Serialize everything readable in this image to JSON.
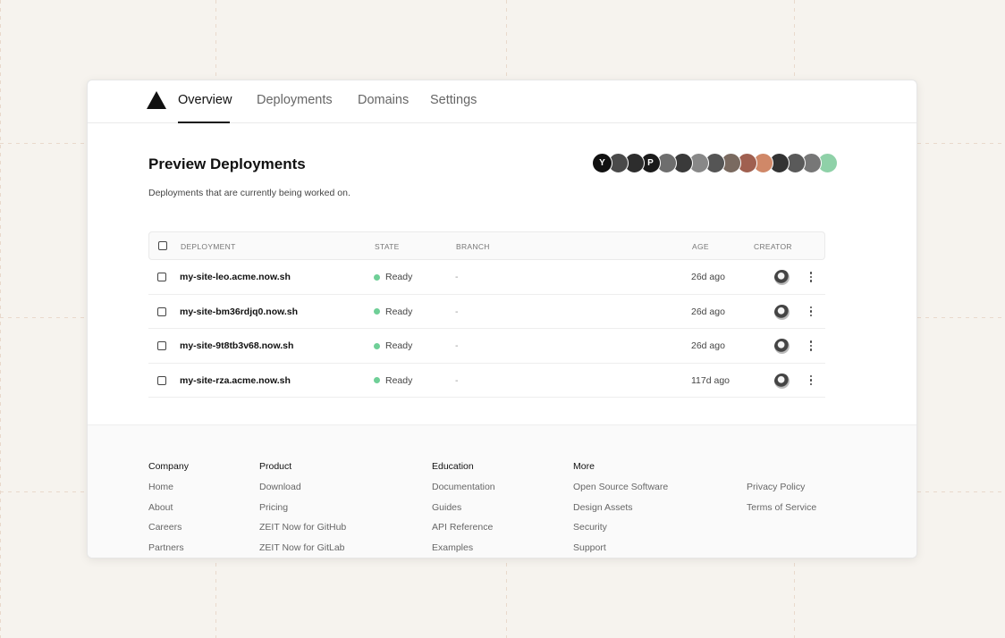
{
  "nav": {
    "tabs": [
      {
        "label": "Overview",
        "active": true
      },
      {
        "label": "Deployments",
        "active": false
      },
      {
        "label": "Domains",
        "active": false
      },
      {
        "label": "Settings",
        "active": false
      }
    ]
  },
  "main": {
    "title": "Preview Deployments",
    "subtitle": "Deployments that are currently being worked on."
  },
  "avatars": {
    "colors": [
      "#111111",
      "#4a4a4a",
      "#2d2d2d",
      "#1a1a1a",
      "#6e6e6e",
      "#3a3a3a",
      "#888888",
      "#555555",
      "#7a6a60",
      "#a06050",
      "#d08868",
      "#333333",
      "#5a5a5a",
      "#777777",
      "#8fd1a8"
    ],
    "glyphs": [
      "Y",
      "",
      "",
      "P",
      "",
      "",
      "",
      "",
      "",
      "",
      "",
      "",
      "",
      "",
      ""
    ]
  },
  "table": {
    "headers": {
      "deployment": "DEPLOYMENT",
      "state": "STATE",
      "branch": "BRANCH",
      "age": "AGE",
      "creator": "CREATOR"
    },
    "rows": [
      {
        "name": "my-site-leo.acme.now.sh",
        "state": "Ready",
        "branch": "-",
        "age": "26d ago"
      },
      {
        "name": "my-site-bm36rdjq0.now.sh",
        "state": "Ready",
        "branch": "-",
        "age": "26d ago"
      },
      {
        "name": "my-site-9t8tb3v68.now.sh",
        "state": "Ready",
        "branch": "-",
        "age": "26d ago"
      },
      {
        "name": "my-site-rza.acme.now.sh",
        "state": "Ready",
        "branch": "-",
        "age": "117d ago"
      }
    ],
    "state_color": "#6fcf97"
  },
  "footer": {
    "company": {
      "heading": "Company",
      "links": [
        "Home",
        "About",
        "Careers",
        "Partners"
      ]
    },
    "product": {
      "heading": "Product",
      "links": [
        "Download",
        "Pricing",
        "ZEIT Now for GitHub",
        "ZEIT Now for GitLab"
      ]
    },
    "education": {
      "heading": "Education",
      "links": [
        "Documentation",
        "Guides",
        "API Reference",
        "Examples"
      ]
    },
    "more": {
      "heading": "More",
      "links": [
        "Open Source Software",
        "Design Assets",
        "Security",
        "Support"
      ]
    },
    "legal": {
      "heading": "",
      "links": [
        "Privacy Policy",
        "Terms of Service"
      ]
    }
  }
}
